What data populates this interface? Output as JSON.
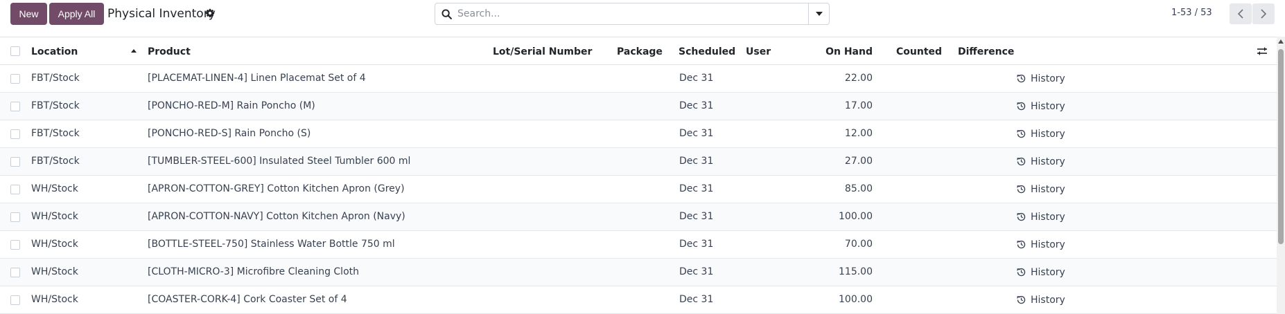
{
  "toolbar": {
    "new_label": "New",
    "apply_all_label": "Apply All",
    "title": "Physical Inventory"
  },
  "search": {
    "placeholder": "Search...",
    "value": ""
  },
  "pager": {
    "value": "1-53 / 53"
  },
  "columns": {
    "location": "Location",
    "product": "Product",
    "lot": "Lot/Serial Number",
    "package": "Package",
    "scheduled": "Scheduled",
    "user": "User",
    "on_hand": "On Hand",
    "counted": "Counted",
    "difference": "Difference"
  },
  "history_label": "History",
  "rows": [
    {
      "location": "FBT/Stock",
      "product": "[PLACEMAT-LINEN-4] Linen Placemat Set of 4",
      "scheduled": "Dec 31",
      "on_hand": "22.00"
    },
    {
      "location": "FBT/Stock",
      "product": "[PONCHO-RED-M] Rain Poncho (M)",
      "scheduled": "Dec 31",
      "on_hand": "17.00"
    },
    {
      "location": "FBT/Stock",
      "product": "[PONCHO-RED-S] Rain Poncho (S)",
      "scheduled": "Dec 31",
      "on_hand": "12.00"
    },
    {
      "location": "FBT/Stock",
      "product": "[TUMBLER-STEEL-600] Insulated Steel Tumbler 600 ml",
      "scheduled": "Dec 31",
      "on_hand": "27.00"
    },
    {
      "location": "WH/Stock",
      "product": "[APRON-COTTON-GREY] Cotton Kitchen Apron (Grey)",
      "scheduled": "Dec 31",
      "on_hand": "85.00"
    },
    {
      "location": "WH/Stock",
      "product": "[APRON-COTTON-NAVY] Cotton Kitchen Apron (Navy)",
      "scheduled": "Dec 31",
      "on_hand": "100.00"
    },
    {
      "location": "WH/Stock",
      "product": "[BOTTLE-STEEL-750] Stainless Water Bottle 750 ml",
      "scheduled": "Dec 31",
      "on_hand": "70.00"
    },
    {
      "location": "WH/Stock",
      "product": "[CLOTH-MICRO-3] Microfibre Cleaning Cloth",
      "scheduled": "Dec 31",
      "on_hand": "115.00"
    },
    {
      "location": "WH/Stock",
      "product": "[COASTER-CORK-4] Cork Coaster Set of 4",
      "scheduled": "Dec 31",
      "on_hand": "100.00"
    }
  ],
  "colors": {
    "primary": "#714b67",
    "border": "#dee2e6",
    "stripe": "#f9fafb"
  }
}
